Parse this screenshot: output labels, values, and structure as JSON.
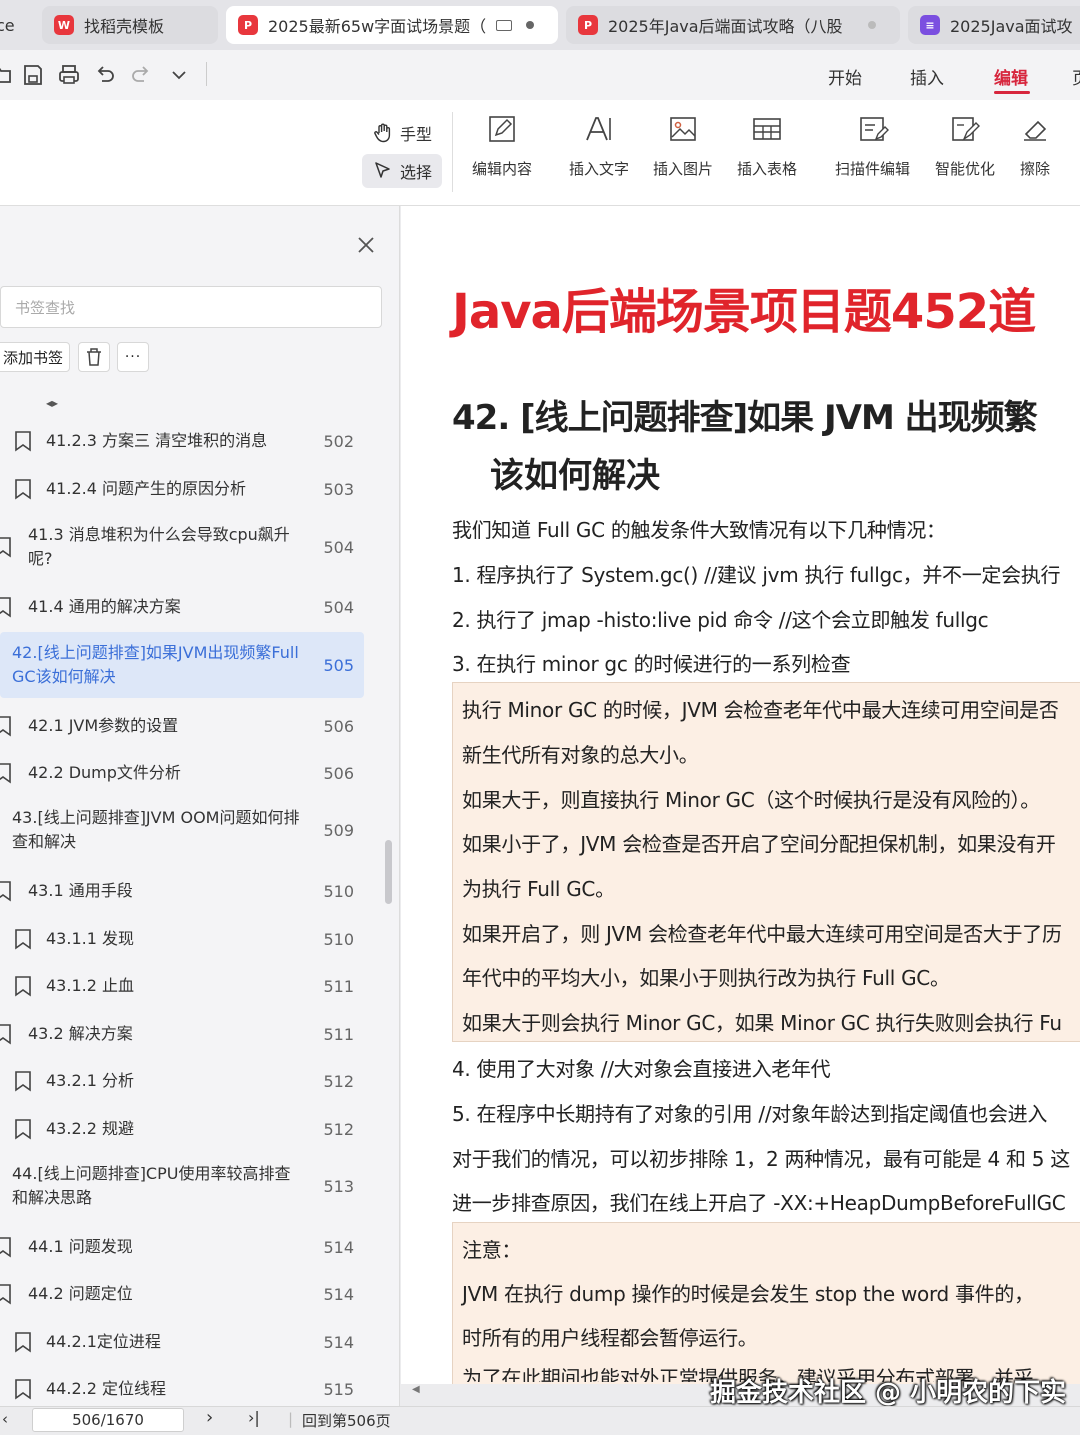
{
  "tabs": [
    {
      "label": "ce"
    },
    {
      "label": "找稻壳模板",
      "icon": "wps-logo-icon",
      "color": "#e8373d"
    },
    {
      "label": "2025最新65w字面试场景题（",
      "icon": "pdf-icon",
      "color": "#e8373d"
    },
    {
      "label": "2025年Java后端面试攻略（八股",
      "icon": "pdf-icon",
      "color": "#e8373d"
    },
    {
      "label": "2025Java面试攻",
      "icon": "doc-icon",
      "color": "#7b4fe0"
    }
  ],
  "menu": {
    "start": "开始",
    "insert": "插入",
    "edit": "编辑",
    "more": "页"
  },
  "ribbon": {
    "hand": "手型",
    "select": "选择",
    "edit_content": "编辑内容",
    "insert_text": "插入文字",
    "insert_image": "插入图片",
    "insert_table": "插入表格",
    "scan_edit": "扫描件编辑",
    "smart_optimize": "智能优化",
    "erase": "擦除"
  },
  "sidebar": {
    "search_placeholder": "书签查找",
    "add_bookmark": "添加书签",
    "more": "···",
    "items": [
      {
        "title": "41.2.3 方案三 清空堆积的消息",
        "page": "502"
      },
      {
        "title": "41.2.4 问题产生的原因分析",
        "page": "503"
      },
      {
        "title": "41.3 消息堆积为什么会导致cpu飙升呢?",
        "page": "504"
      },
      {
        "title": "41.4 通用的解决方案",
        "page": "504"
      },
      {
        "title": "42.[线上问题排查]如果JVM出现频繁Full GC该如何解决",
        "page": "505"
      },
      {
        "title": "42.1 JVM参数的设置",
        "page": "506"
      },
      {
        "title": "42.2 Dump文件分析",
        "page": "506"
      },
      {
        "title": "43.[线上问题排查]JVM OOM问题如何排查和解决",
        "page": "509"
      },
      {
        "title": "43.1 通用手段",
        "page": "510"
      },
      {
        "title": "43.1.1 发现",
        "page": "510"
      },
      {
        "title": "43.1.2 止血",
        "page": "511"
      },
      {
        "title": "43.2 解决方案",
        "page": "511"
      },
      {
        "title": "43.2.1 分析",
        "page": "512"
      },
      {
        "title": "43.2.2 规避",
        "page": "512"
      },
      {
        "title": "44.[线上问题排查]CPU使用率较高排查和解决思路",
        "page": "513"
      },
      {
        "title": "44.1 问题发现",
        "page": "514"
      },
      {
        "title": "44.2 问题定位",
        "page": "514"
      },
      {
        "title": "44.2.1定位进程",
        "page": "514"
      },
      {
        "title": "44.2.2 定位线程",
        "page": "515"
      }
    ]
  },
  "document": {
    "title": "Java后端场景项目题452道",
    "heading_line1": "42.  [线上问题排查]如果 JVM 出现频繁",
    "heading_line2": "该如何解决",
    "intro": "我们知道 Full GC 的触发条件大致情况有以下几种情况：",
    "list1": "1.    程序执行了 System.gc() //建议 jvm 执行 fullgc，并不一定会执行",
    "list2": "2.    执行了 jmap -histo:live pid 命令  //这个会立即触发 fullgc",
    "list3": "3.    在执行 minor gc 的时候进行的一系列检查",
    "box1": [
      "执行 Minor GC 的时候，JVM 会检查老年代中最大连续可用空间是否",
      "新生代所有对象的总大小。",
      "如果大于，则直接执行 Minor GC（这个时候执行是没有风险的）。",
      "如果小于了，JVM 会检查是否开启了空间分配担保机制，如果没有开",
      "为执行 Full GC。",
      "如果开启了，则 JVM 会检查老年代中最大连续可用空间是否大于了历",
      "年代中的平均大小，如果小于则执行改为执行 Full GC。",
      "如果大于则会执行 Minor GC，如果 Minor GC 执行失败则会执行 Fu"
    ],
    "list4": "4.    使用了大对象  //大对象会直接进入老年代",
    "list5": "5.    在程序中长期持有了对象的引用  //对象年龄达到指定阈值也会进入",
    "para1": "对于我们的情况，可以初步排除 1，2 两种情况，最有可能是 4 和 5 这",
    "para2": "进一步排查原因，我们在线上开启了 -XX:+HeapDumpBeforeFullGC",
    "note_title": "注意：",
    "note_line1": "     JVM 在执行 dump 操作的时候是会发生 stop the word 事件的，",
    "note_line2": "时所有的用户线程都会暂停运行。",
    "note_line3": "     为了在此期间也能对外正常提供服务，建议采用分布式部署，并采"
  },
  "watermark": "掘金技术社区 @ 小明农的下实",
  "status": {
    "page_input": "506/1670",
    "back_to_page": "回到第506页"
  }
}
